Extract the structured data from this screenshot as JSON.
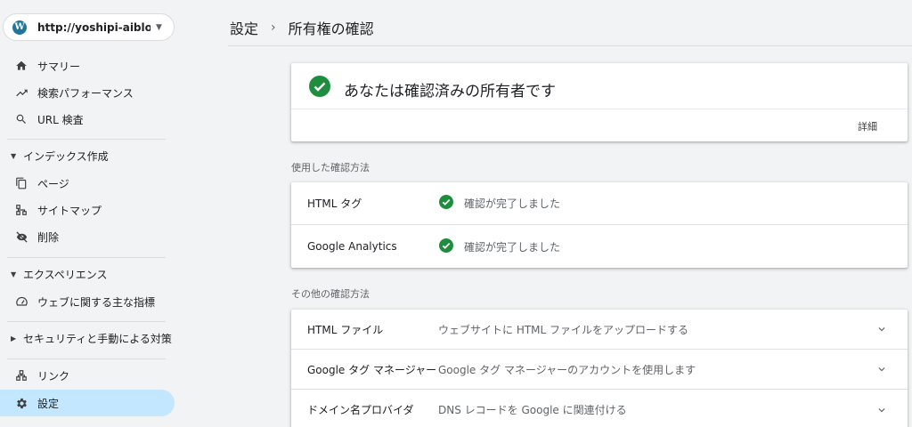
{
  "property": {
    "url": "http://yoshipi-aiblog.co...",
    "logo": "W"
  },
  "nav": {
    "summary": "サマリー",
    "performance": "検索パフォーマンス",
    "url_inspection": "URL 検査",
    "indexing_header": "インデックス作成",
    "pages": "ページ",
    "sitemaps": "サイトマップ",
    "removals": "削除",
    "experience_header": "エクスペリエンス",
    "core_web_vitals": "ウェブに関する主な指標",
    "security_header": "セキュリティと手動による対策",
    "links": "リンク",
    "settings": "設定"
  },
  "breadcrumb": {
    "parent": "設定",
    "separator": "›",
    "current": "所有権の確認"
  },
  "verified": {
    "title": "あなたは確認済みの所有者です",
    "detail_label": "詳細"
  },
  "used_methods": {
    "title": "使用した確認方法",
    "rows": [
      {
        "label": "HTML タグ",
        "status": "確認が完了しました"
      },
      {
        "label": "Google Analytics",
        "status": "確認が完了しました"
      }
    ]
  },
  "other_methods": {
    "title": "その他の確認方法",
    "rows": [
      {
        "label": "HTML ファイル",
        "desc": "ウェブサイトに HTML ファイルをアップロードする"
      },
      {
        "label": "Google タグ マネージャー",
        "desc": "Google タグ マネージャーのアカウントを使用します"
      },
      {
        "label": "ドメイン名プロバイダ",
        "desc": "DNS レコードを Google に関連付ける"
      }
    ]
  },
  "colors": {
    "success": "#1e8e3e",
    "active_nav": "#c2e7ff",
    "wordpress": "#21759b"
  }
}
